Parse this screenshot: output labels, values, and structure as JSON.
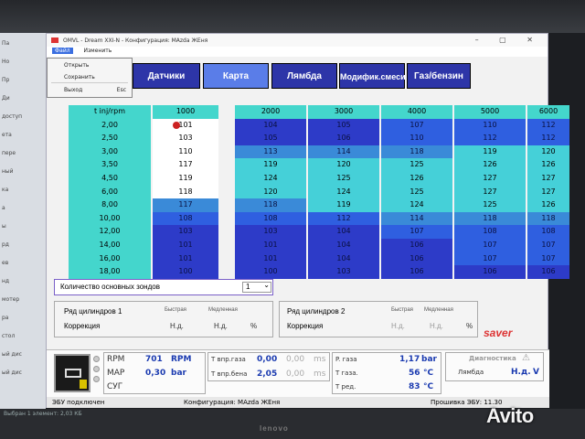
{
  "window": {
    "title": "OMVL - Dream XXI-N - Конфигурация: MAzda ЖЕня",
    "controls": "–  ▢  ✕"
  },
  "menu": {
    "file": "Файл",
    "edit": "Изменить"
  },
  "file_menu": [
    {
      "label": "Открыть",
      "shortcut": ""
    },
    {
      "label": "Сохранить",
      "shortcut": ""
    },
    {
      "label": "Выход",
      "shortcut": "Esc"
    }
  ],
  "tabs": [
    {
      "label": "Датчики",
      "selected": false
    },
    {
      "label": "Карта",
      "selected": true
    },
    {
      "label": "Лямбда",
      "selected": false
    },
    {
      "label": "Модифик.смеси",
      "selected": false
    },
    {
      "label": "Газ/бензин",
      "selected": false
    }
  ],
  "map": {
    "corner": "t inj/rpm",
    "rpm": [
      "1000",
      "2000",
      "3000",
      "4000",
      "5000",
      "6000"
    ],
    "tinj": [
      "2,00",
      "2,50",
      "3,00",
      "3,50",
      "4,50",
      "6,00",
      "8,00",
      "10,00",
      "12,00",
      "14,00",
      "16,00",
      "18,00"
    ],
    "values": [
      [
        "101",
        "104",
        "105",
        "107",
        "110",
        "112"
      ],
      [
        "103",
        "105",
        "106",
        "110",
        "112",
        "112"
      ],
      [
        "110",
        "113",
        "114",
        "118",
        "119",
        "120"
      ],
      [
        "117",
        "119",
        "120",
        "125",
        "126",
        "126"
      ],
      [
        "119",
        "124",
        "125",
        "126",
        "127",
        "127"
      ],
      [
        "118",
        "120",
        "124",
        "125",
        "127",
        "127"
      ],
      [
        "117",
        "118",
        "119",
        "124",
        "125",
        "126"
      ],
      [
        "108",
        "108",
        "112",
        "114",
        "118",
        "118"
      ],
      [
        "103",
        "103",
        "104",
        "107",
        "108",
        "108"
      ],
      [
        "101",
        "101",
        "104",
        "106",
        "107",
        "107"
      ],
      [
        "101",
        "101",
        "104",
        "106",
        "107",
        "107"
      ],
      [
        "100",
        "100",
        "103",
        "106",
        "106",
        "106"
      ]
    ]
  },
  "probes": {
    "label": "Количество основных зондов",
    "value": "1",
    "arrow": "⌄"
  },
  "bank1": {
    "title": "Ряд цилиндров 1",
    "fast": "Быстрая",
    "slow": "Медленная",
    "corr": "Коррекция",
    "fast_val": "Н.д.",
    "slow_val": "Н.д.",
    "unit": "%"
  },
  "bank2": {
    "title": "Ряд цилиндров 2",
    "fast": "Быстрая",
    "slow": "Медленная",
    "corr": "Коррекция",
    "fast_val": "Н.д.",
    "slow_val": "Н.д.",
    "unit": "%"
  },
  "brand": "saver",
  "params": {
    "rpm_label": "RPM",
    "rpm_value": "701",
    "rpm_unit": "RPM",
    "map_label": "MAP",
    "map_value": "0,30",
    "map_unit": "bar",
    "sug_label": "СУГ",
    "tgas_label": "T впр.газа",
    "tgas_value": "0,00",
    "tgas2": "0,00",
    "tgas_unit": "ms",
    "tpet_label": "T впр.бена",
    "tpet_value": "2,05",
    "tpet2": "0,00",
    "tpet_unit": "ms",
    "pgas_label": "P. газа",
    "pgas_value": "1,17",
    "pgas_unit": "bar",
    "tgasT_label": "T газа.",
    "tgasT_value": "56",
    "tgasT_unit": "°C",
    "tred_label": "T ред.",
    "tred_value": "83",
    "tred_unit": "°C",
    "diag_label": "Диагностика",
    "lambda_label": "Лямбда",
    "lambda_value": "Н.д.",
    "lambda_unit": "V"
  },
  "status": {
    "left": "ЭБУ подключен",
    "config": "Конфигурация: MAzda ЖЕня",
    "fw": "Прошивка ЭБУ: 11.30"
  },
  "photo": {
    "avito": "Avito",
    "lenovo": "lenovo",
    "left_texts": [
      "Па",
      "Но",
      "Пр",
      "Ди",
      "доступ",
      "ета",
      "пере",
      "ный",
      "ка",
      "а",
      "ы",
      "рд",
      "ев",
      "нд",
      "мотер",
      "ра",
      "стол",
      "ый дис",
      "ый дис"
    ],
    "bottom_text": "Выбран 1 элемент: 2,03 КБ"
  },
  "colors": {
    "header": "#44d6cc",
    "white": "#ffffff",
    "low": "#2d3bc8",
    "mid": "#2f5fe0",
    "light": "#3a8ad8",
    "cyan": "#45d0d8"
  }
}
